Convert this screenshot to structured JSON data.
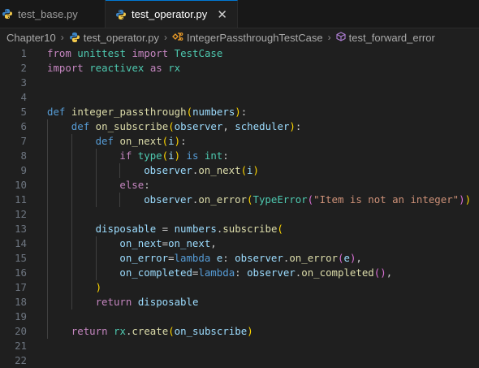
{
  "tabs": [
    {
      "label": "test_base.py",
      "active": false
    },
    {
      "label": "test_operator.py",
      "active": true
    }
  ],
  "breadcrumb": {
    "folder": "Chapter10",
    "file": "test_operator.py",
    "class": "IntegerPassthroughTestCase",
    "method": "test_forward_error"
  },
  "code_lines": [
    {
      "n": "1",
      "indent": 0,
      "tokens": [
        [
          "from",
          "k"
        ],
        [
          " unittest ",
          "t"
        ],
        [
          "import",
          "k"
        ],
        [
          " TestCase",
          "t"
        ]
      ]
    },
    {
      "n": "2",
      "indent": 0,
      "tokens": [
        [
          "import",
          "k"
        ],
        [
          " reactivex ",
          "t"
        ],
        [
          "as",
          "k"
        ],
        [
          " rx",
          "t"
        ]
      ]
    },
    {
      "n": "3",
      "indent": 0,
      "tokens": []
    },
    {
      "n": "4",
      "indent": 0,
      "tokens": []
    },
    {
      "n": "5",
      "indent": 0,
      "tokens": [
        [
          "def",
          "kb"
        ],
        [
          " ",
          "w"
        ],
        [
          "integer_passthrough",
          "f"
        ],
        [
          "(",
          "p1"
        ],
        [
          "numbers",
          "v"
        ],
        [
          ")",
          "p1"
        ],
        [
          ":",
          "w"
        ]
      ]
    },
    {
      "n": "6",
      "indent": 1,
      "tokens": [
        [
          "def",
          "kb"
        ],
        [
          " ",
          "w"
        ],
        [
          "on_subscribe",
          "f"
        ],
        [
          "(",
          "p1"
        ],
        [
          "observer",
          "v"
        ],
        [
          ", ",
          "w"
        ],
        [
          "scheduler",
          "v"
        ],
        [
          ")",
          "p1"
        ],
        [
          ":",
          "w"
        ]
      ]
    },
    {
      "n": "7",
      "indent": 2,
      "tokens": [
        [
          "def",
          "kb"
        ],
        [
          " ",
          "w"
        ],
        [
          "on_next",
          "f"
        ],
        [
          "(",
          "p1"
        ],
        [
          "i",
          "v"
        ],
        [
          ")",
          "p1"
        ],
        [
          ":",
          "w"
        ]
      ]
    },
    {
      "n": "8",
      "indent": 3,
      "tokens": [
        [
          "if",
          "k"
        ],
        [
          " ",
          "w"
        ],
        [
          "type",
          "t"
        ],
        [
          "(",
          "p1"
        ],
        [
          "i",
          "v"
        ],
        [
          ")",
          "p1"
        ],
        [
          " ",
          "w"
        ],
        [
          "is",
          "kb"
        ],
        [
          " ",
          "w"
        ],
        [
          "int",
          "t"
        ],
        [
          ":",
          "w"
        ]
      ]
    },
    {
      "n": "9",
      "indent": 4,
      "tokens": [
        [
          "observer",
          "v"
        ],
        [
          ".",
          "w"
        ],
        [
          "on_next",
          "f"
        ],
        [
          "(",
          "p1"
        ],
        [
          "i",
          "v"
        ],
        [
          ")",
          "p1"
        ]
      ]
    },
    {
      "n": "10",
      "indent": 3,
      "tokens": [
        [
          "else",
          "k"
        ],
        [
          ":",
          "w"
        ]
      ]
    },
    {
      "n": "11",
      "indent": 4,
      "tokens": [
        [
          "observer",
          "v"
        ],
        [
          ".",
          "w"
        ],
        [
          "on_error",
          "f"
        ],
        [
          "(",
          "p1"
        ],
        [
          "TypeError",
          "t"
        ],
        [
          "(",
          "p2"
        ],
        [
          "\"Item is not an integer\"",
          "s"
        ],
        [
          ")",
          "p2"
        ],
        [
          ")",
          "p1"
        ]
      ]
    },
    {
      "n": "12",
      "indent": 0,
      "tokens": []
    },
    {
      "n": "13",
      "indent": 2,
      "tokens": [
        [
          "disposable",
          "v"
        ],
        [
          " = ",
          "w"
        ],
        [
          "numbers",
          "v"
        ],
        [
          ".",
          "w"
        ],
        [
          "subscribe",
          "f"
        ],
        [
          "(",
          "p1"
        ]
      ]
    },
    {
      "n": "14",
      "indent": 3,
      "tokens": [
        [
          "on_next",
          "v"
        ],
        [
          "=",
          "w"
        ],
        [
          "on_next",
          "v"
        ],
        [
          ",",
          "w"
        ]
      ]
    },
    {
      "n": "15",
      "indent": 3,
      "tokens": [
        [
          "on_error",
          "v"
        ],
        [
          "=",
          "w"
        ],
        [
          "lambda",
          "kb"
        ],
        [
          " ",
          "w"
        ],
        [
          "e",
          "v"
        ],
        [
          ": ",
          "w"
        ],
        [
          "observer",
          "v"
        ],
        [
          ".",
          "w"
        ],
        [
          "on_error",
          "f"
        ],
        [
          "(",
          "p2"
        ],
        [
          "e",
          "v"
        ],
        [
          ")",
          "p2"
        ],
        [
          ",",
          "w"
        ]
      ]
    },
    {
      "n": "16",
      "indent": 3,
      "tokens": [
        [
          "on_completed",
          "v"
        ],
        [
          "=",
          "w"
        ],
        [
          "lambda",
          "kb"
        ],
        [
          ": ",
          "w"
        ],
        [
          "observer",
          "v"
        ],
        [
          ".",
          "w"
        ],
        [
          "on_completed",
          "f"
        ],
        [
          "(",
          "p2"
        ],
        [
          ")",
          "p2"
        ],
        [
          ",",
          "w"
        ]
      ]
    },
    {
      "n": "17",
      "indent": 2,
      "tokens": [
        [
          ")",
          "p1"
        ]
      ]
    },
    {
      "n": "18",
      "indent": 2,
      "tokens": [
        [
          "return",
          "k"
        ],
        [
          " ",
          "w"
        ],
        [
          "disposable",
          "v"
        ]
      ]
    },
    {
      "n": "19",
      "indent": 0,
      "tokens": []
    },
    {
      "n": "20",
      "indent": 1,
      "tokens": [
        [
          "return",
          "k"
        ],
        [
          " ",
          "w"
        ],
        [
          "rx",
          "t"
        ],
        [
          ".",
          "w"
        ],
        [
          "create",
          "f"
        ],
        [
          "(",
          "p1"
        ],
        [
          "on_subscribe",
          "v"
        ],
        [
          ")",
          "p1"
        ]
      ]
    },
    {
      "n": "21",
      "indent": 0,
      "tokens": []
    },
    {
      "n": "22",
      "indent": 0,
      "tokens": []
    }
  ],
  "colors": {
    "background": "#1f1f1f",
    "tab_active_border": "#0078d4",
    "keyword": "#c586c0",
    "function": "#dcdcaa",
    "variable": "#9cdcfe",
    "type": "#4ec9b0",
    "string": "#ce9178"
  }
}
